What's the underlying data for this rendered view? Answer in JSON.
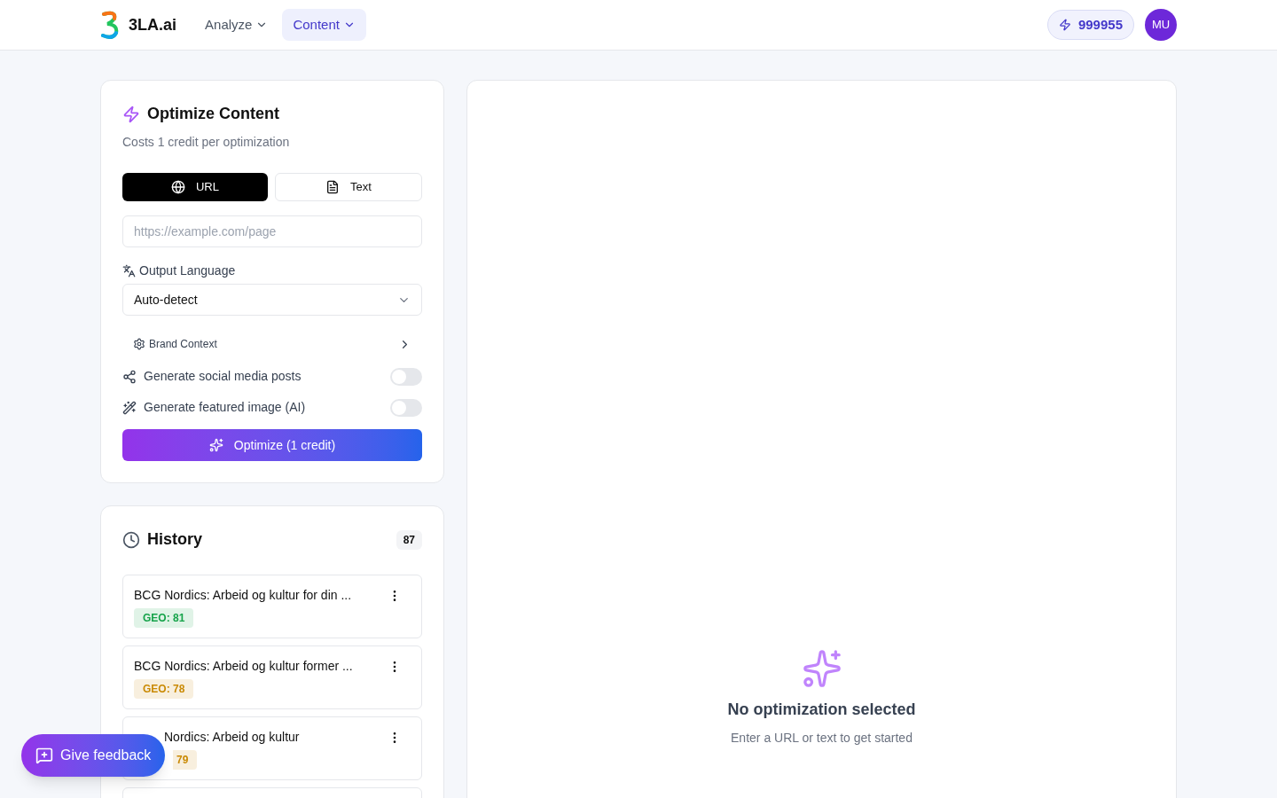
{
  "header": {
    "brand": "3LA.ai",
    "nav": [
      {
        "label": "Analyze",
        "selected": false
      },
      {
        "label": "Content",
        "selected": true
      }
    ],
    "credits": "999955",
    "avatar": "MU"
  },
  "optimize": {
    "title": "Optimize Content",
    "subtitle": "Costs 1 credit per optimization",
    "modes": [
      {
        "label": "URL",
        "kind": "globe",
        "selected": true
      },
      {
        "label": "Text",
        "kind": "file",
        "selected": false
      }
    ],
    "url": {
      "placeholder": "https://example.com/page"
    },
    "language_label": "Output Language",
    "language": "Auto-detect",
    "brand_context": "Brand Context",
    "toggles": [
      {
        "label": "Generate social media posts",
        "kind": "share",
        "on": false
      },
      {
        "label": "Generate featured image (AI)",
        "kind": "wand",
        "on": false
      }
    ],
    "button": "Optimize (1 credit)"
  },
  "history": {
    "title": "History",
    "count": "87",
    "items": [
      {
        "title": "BCG Nordics: Arbeid og kultur for din ...",
        "score": "GEO: 81",
        "color": "#16a34a"
      },
      {
        "title": "BCG Nordics: Arbeid og kultur former ...",
        "score": "GEO: 78",
        "color": "#ca8a04"
      },
      {
        "title": "Nordics: Arbeid og kultur",
        "score": "79",
        "color": "#ca8a04",
        "kind": "covered"
      }
    ]
  },
  "empty": {
    "title": "No optimization selected",
    "subtitle": "Enter a URL or text to get started"
  },
  "feedback": "Give feedback"
}
